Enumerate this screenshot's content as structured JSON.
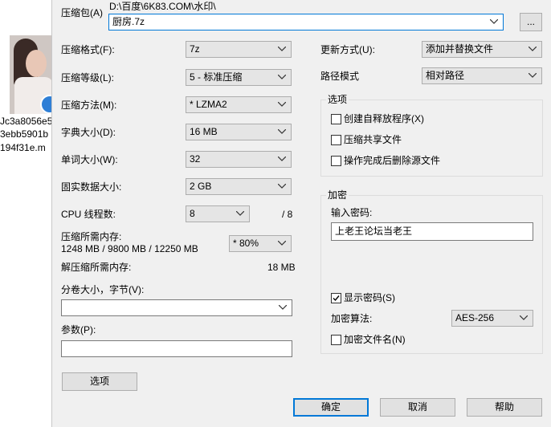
{
  "desktop": {
    "files": [
      "Jc3a8056e5",
      "3ebb5901b",
      "194f31e.m"
    ]
  },
  "dialog": {
    "archive_label": "压缩包(A)",
    "archive_path": "D:\\百度\\6K83.COM\\水印\\",
    "archive_name": "厨房.7z",
    "browse_label": "...",
    "format_label": "压缩格式(F):",
    "format_value": "7z",
    "level_label": "压缩等级(L):",
    "level_value": "5 - 标准压缩",
    "method_label": "压缩方法(M):",
    "method_value": "*  LZMA2",
    "dict_label": "字典大小(D):",
    "dict_value": "16 MB",
    "word_label": "单词大小(W):",
    "word_value": "32",
    "solid_label": "固实数据大小:",
    "solid_value": "2 GB",
    "threads_label": "CPU 线程数:",
    "threads_value": "8",
    "threads_total": "/ 8",
    "mem_label": "压缩所需内存:",
    "mem_detail": "1248 MB / 9800 MB / 12250 MB",
    "mem_percent": "* 80%",
    "decomp_label": "解压缩所需内存:",
    "decomp_value": "18 MB",
    "volume_label": "分卷大小，字节(V):",
    "volume_value": "",
    "params_label": "参数(P):",
    "params_value": "",
    "options_button": "选项",
    "update_label": "更新方式(U):",
    "update_value": "添加并替换文件",
    "path_label": "路径模式",
    "path_value": "相对路径",
    "options_group": "选项",
    "opt_sfx": "创建自释放程序(X)",
    "opt_shared": "压缩共享文件",
    "opt_delete": "操作完成后删除源文件",
    "enc_group": "加密",
    "password_label": "输入密码:",
    "password_value": "上老王论坛当老王",
    "show_password": "显示密码(S)",
    "enc_method_label": "加密算法:",
    "enc_method_value": "AES-256",
    "enc_filenames": "加密文件名(N)",
    "ok_button": "确定",
    "cancel_button": "取消",
    "help_button": "帮助"
  }
}
